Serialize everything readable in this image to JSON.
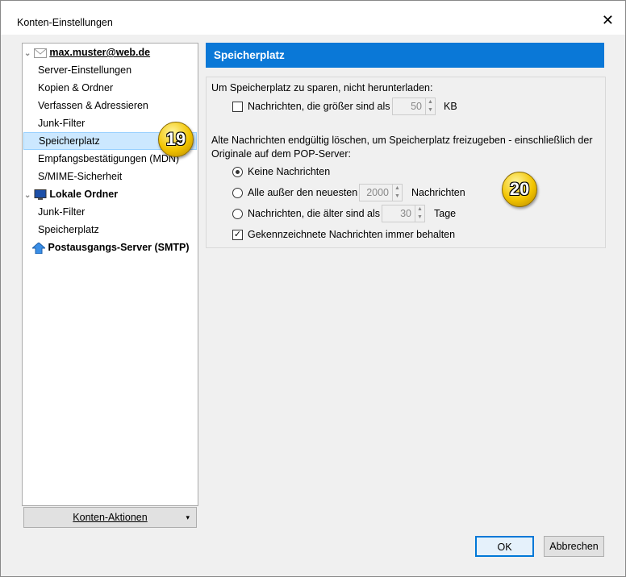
{
  "window": {
    "title": "Konten-Einstellungen",
    "close": "✕"
  },
  "tree": [
    {
      "label": "max.muster@web.de",
      "type": "account"
    },
    {
      "label": "Server-Einstellungen"
    },
    {
      "label": "Kopien & Ordner"
    },
    {
      "label": "Verfassen & Adressieren"
    },
    {
      "label": "Junk-Filter"
    },
    {
      "label": "Speicherplatz",
      "selected": true
    },
    {
      "label": "Empfangsbestätigungen (MDN)"
    },
    {
      "label": "S/MIME-Sicherheit"
    },
    {
      "label": "Lokale Ordner",
      "type": "local"
    },
    {
      "label": "Junk-Filter"
    },
    {
      "label": "Speicherplatz"
    },
    {
      "label": "Postausgangs-Server (SMTP)",
      "type": "smtp"
    }
  ],
  "account_actions": {
    "label": "Konten-Aktionen",
    "arrow": "▾"
  },
  "panel": {
    "header": "Speicherplatz",
    "download_label": "Um Speicherplatz zu sparen, nicht herunterladen:",
    "size_check": {
      "label": "Nachrichten, die größer sind als",
      "checked": false,
      "value": "50",
      "unit": "KB"
    },
    "delete_label": "Alte Nachrichten endgültig löschen, um Speicherplatz freizugeben - einschließlich der Originale auf dem POP-Server:",
    "radio_none": {
      "label": "Keine Nachrichten",
      "checked": true
    },
    "radio_keep": {
      "label": "Alle außer den neuesten",
      "value": "2000",
      "unit": "Nachrichten"
    },
    "radio_age": {
      "label": "Nachrichten, die älter sind als",
      "value": "30",
      "unit": "Tage"
    },
    "flagged": {
      "label": "Gekennzeichnete Nachrichten immer behalten",
      "checked": true
    }
  },
  "buttons": {
    "ok": "OK",
    "cancel": "Abbrechen"
  },
  "badges": {
    "b19": "19",
    "b20": "20"
  }
}
